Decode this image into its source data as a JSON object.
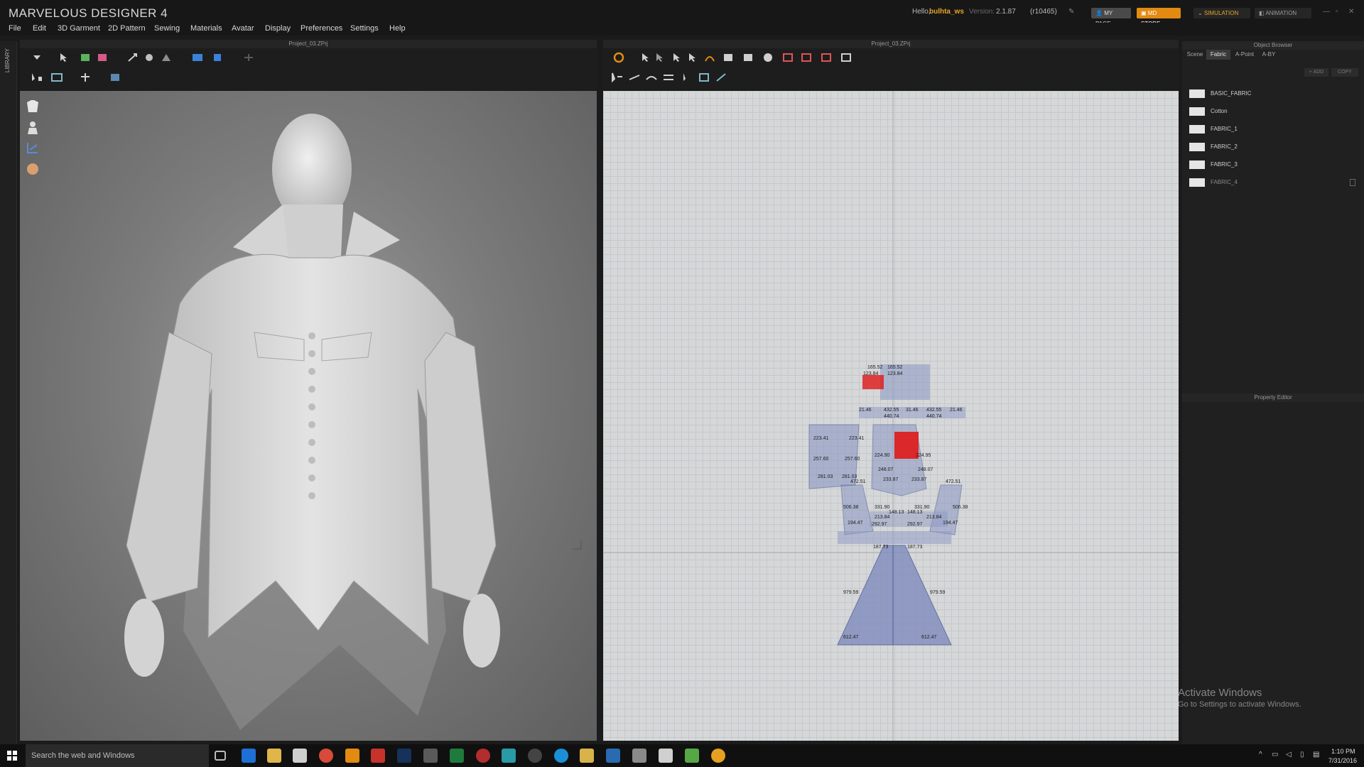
{
  "app": {
    "title": "MARVELOUS DESIGNER 4",
    "greeting": "Hello,",
    "username": "bulhta_ws",
    "version_label": "Version:",
    "version": "2.1.87",
    "build": "(r10465)",
    "my_page": "MY PAGE",
    "md_store": "MD STORE",
    "simulation": "SIMULATION",
    "animation": "ANIMATION"
  },
  "menu": [
    "File",
    "Edit",
    "3D Garment",
    "2D Pattern",
    "Sewing",
    "Materials",
    "Avatar",
    "Display",
    "Preferences",
    "Settings",
    "Help"
  ],
  "library_label": "LIBRARY",
  "view3d": {
    "project_title": "Project_03.ZPrj"
  },
  "view2d": {
    "project_title": "Project_03.ZPrj",
    "labels": [
      "165.52",
      "165.52",
      "123.84",
      "123.84",
      "21.46",
      "432.55",
      "31.46",
      "432.55",
      "21.46",
      "440.74",
      "440.74",
      "223.41",
      "223.41",
      "257.60",
      "257.60",
      "281.03",
      "281.03",
      "224.90",
      "224.95",
      "248.07",
      "248.07",
      "233.87",
      "233.87",
      "472.51",
      "472.51",
      "506.38",
      "506.38",
      "194.47",
      "194.47",
      "331.90",
      "331.90",
      "148.13",
      "148.13",
      "213.84",
      "213.84",
      "292.97",
      "292.97",
      "187.73",
      "187.73",
      "979.59",
      "979.59",
      "612.47",
      "612.47"
    ]
  },
  "object_browser": {
    "title": "Object Browser",
    "tabs": [
      "Scene",
      "Fabric",
      "A-Point",
      "A-BY"
    ],
    "active_tab": "Fabric",
    "add": "ADD",
    "copy": "COPY",
    "fabrics": [
      "BASIC_FABRIC",
      "Cotton",
      "FABRIC_1",
      "FABRIC_2",
      "FABRIC_3",
      "FABRIC_4"
    ]
  },
  "property_editor": {
    "title": "Property Editor"
  },
  "watermark": {
    "title": "Activate Windows",
    "subtitle": "Go to Settings to activate Windows."
  },
  "taskbar": {
    "search_placeholder": "Search the web and Windows",
    "time": "1:10 PM",
    "date": "7/31/2016"
  },
  "colors": {
    "accent": "#e28a12",
    "pattern_fill": "#8b97c4",
    "selection_red": "#e01818"
  }
}
